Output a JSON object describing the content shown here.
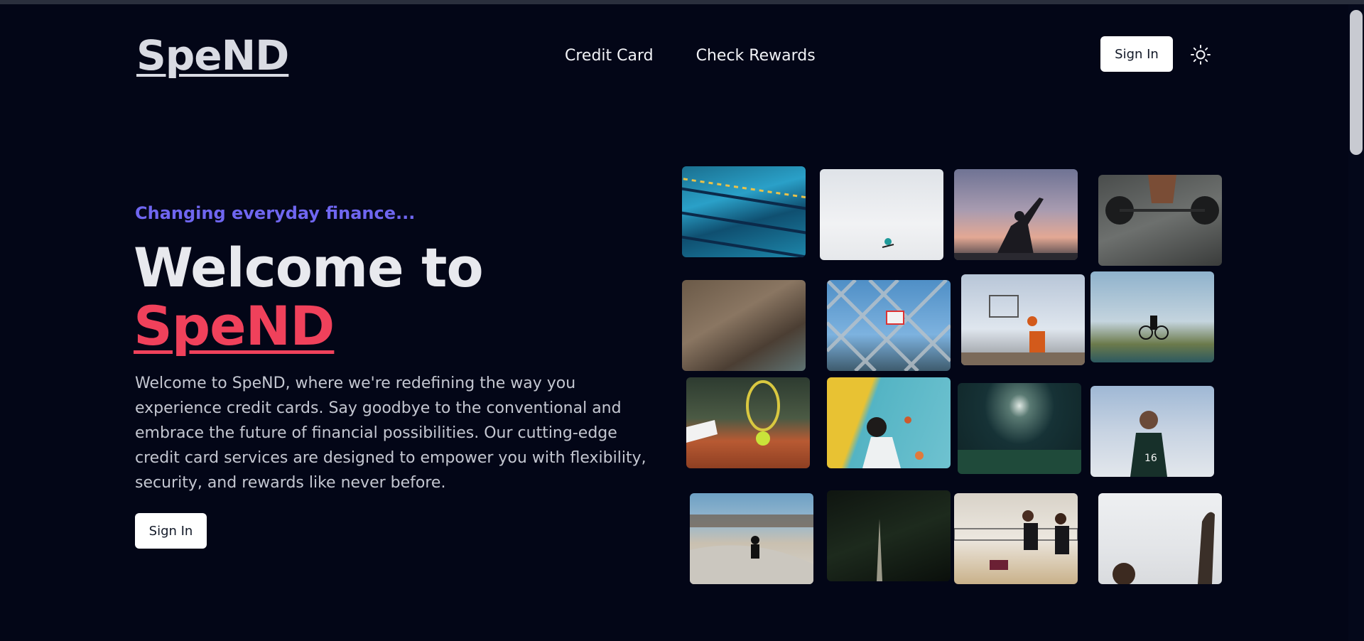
{
  "header": {
    "logo": "SpeND",
    "nav": [
      "Credit Card",
      "Check Rewards"
    ],
    "signin_label": "Sign In",
    "theme_icon": "sun-icon"
  },
  "hero": {
    "tagline": "Changing everyday finance...",
    "headline_prefix": "Welcome to",
    "headline_brand": "SpeND",
    "description": "Welcome to SpeND, where we're redefining the way you experience credit cards. Say goodbye to the conventional and embrace the future of financial possibilities. Our cutting-edge credit card services are designed to empower you with flexibility, security, and rewards like never before.",
    "signin_label": "Sign In"
  },
  "gallery": {
    "tiles": [
      "swimming-pool-photo",
      "snowboarder-photo",
      "yoga-silhouette-photo",
      "weightlifting-photo",
      "climbing-hold-photo",
      "basketball-fence-photo",
      "basketball-shot-photo",
      "mountain-biker-photo",
      "tennis-racket-photo",
      "climbing-wall-photo",
      "night-field-photo",
      "soccer-player-photo",
      "skatepark-photo",
      "dark-sport-photo",
      "volleyball-photo",
      "basketball-hoop-photo"
    ]
  },
  "colors": {
    "background": "#030617",
    "accent_brand": "#f0415b",
    "accent_tagline": "#6f66f0"
  }
}
